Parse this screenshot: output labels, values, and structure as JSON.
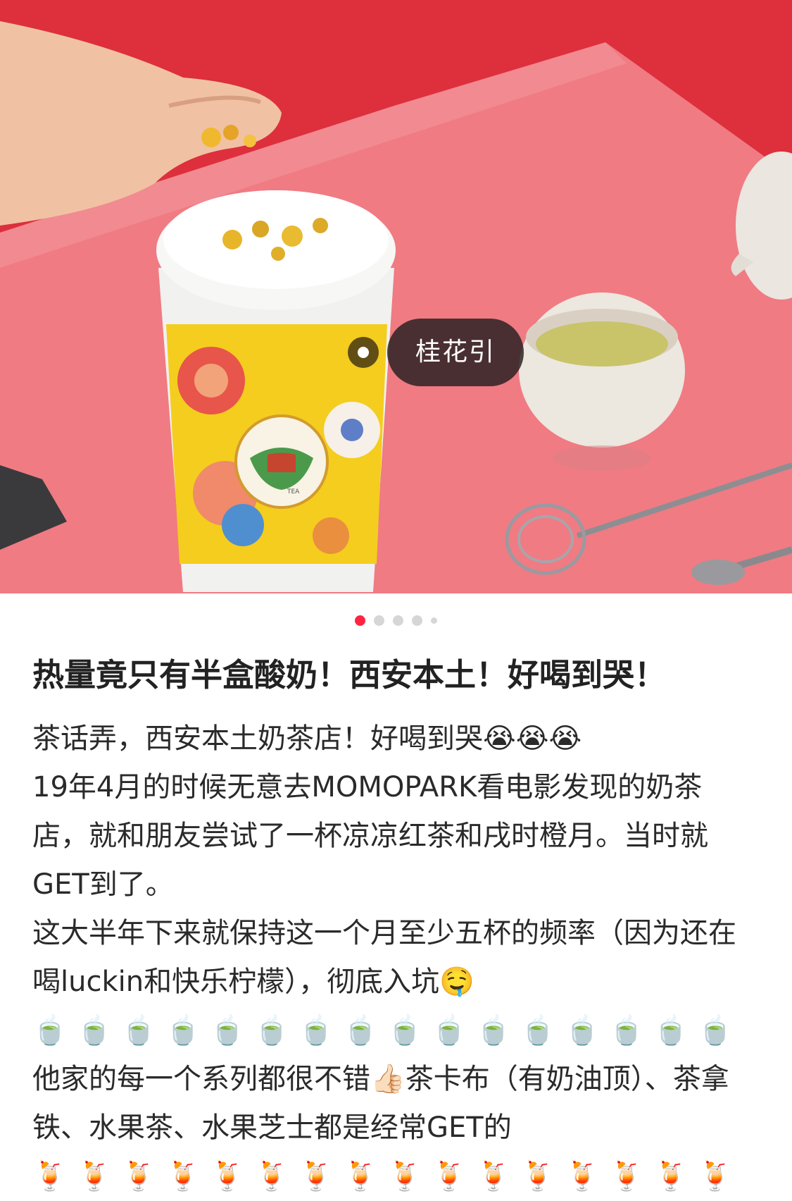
{
  "hero": {
    "tag_label": "桂花引",
    "cup_logo_text": "TEA",
    "colors": {
      "backdrop_red": "#e43a45",
      "table_pink": "#f08a91",
      "tag_bg": "#231e1e",
      "cup_yellow": "#f4cd1e"
    }
  },
  "pager": {
    "count": 5,
    "active_index": 0,
    "active_color": "#ff2442"
  },
  "post": {
    "title": "热量竟只有半盒酸奶！西安本土！好喝到哭！",
    "lines": [
      "茶话弄，西安本土奶茶店！好喝到哭😭😭😭",
      "19年4月的时候无意去MOMOPARK看电影发现的奶茶店，就和朋友尝试了一杯凉凉红茶和戌时橙月。当时就GET到了。",
      "这大半年下来就保持这一个月至少五杯的频率（因为还在喝luckin和快乐柠檬），彻底入坑🤤",
      "他家的每一个系列都很不错👍🏻茶卡布（有奶油顶）、茶拿铁、水果茶、水果芝士都是经常GET的"
    ],
    "tea_emoji_row": [
      "🍵",
      "🍵",
      "🍵",
      "🍵",
      "🍵",
      "🍵",
      "🍵",
      "🍵",
      "🍵",
      "🍵",
      "🍵",
      "🍵",
      "🍵",
      "🍵",
      "🍵",
      "🍵"
    ],
    "drink_emoji_row": [
      "🍹",
      "🍹",
      "🍹",
      "🍹",
      "🍹",
      "🍹",
      "🍹",
      "🍹",
      "🍹",
      "🍹",
      "🍹",
      "🍹",
      "🍹",
      "🍹",
      "🍹",
      "🍹"
    ]
  }
}
